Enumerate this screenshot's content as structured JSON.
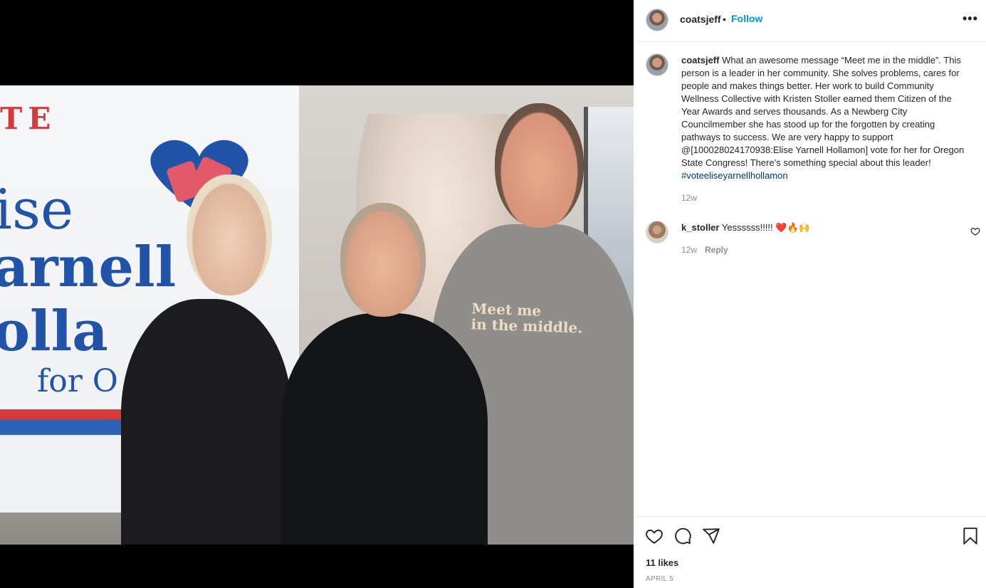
{
  "post": {
    "username": "coatsjeff",
    "follow_separator": "•",
    "follow_label": "Follow",
    "more_label": "•••"
  },
  "photo": {
    "banner_line1": "TE",
    "banner_line2": "ise",
    "banner_line3": "arnell",
    "banner_line4": "olla",
    "banner_line5": "for O",
    "shirt_line1": "Meet me",
    "shirt_line2": "in the middle."
  },
  "caption": {
    "username": "coatsjeff",
    "text": "What an awesome message “Meet me in the middle”. This person is a leader in her community. She solves problems, cares for people and makes things better. Her work to build Community Wellness Collective with Kristen Stoller earned them Citizen of the Year Awards and serves thousands. As a Newberg City Councilmember she has stood up for the forgotten by creating pathways to success. We are very happy to support @[100028024170938:Elise Yarnell Hollamon] vote for her for Oregon State Congress! There’s something special about this leader!",
    "hashtag": "#voteeliseyarnellhollamon",
    "time": "12w"
  },
  "comments": [
    {
      "username": "k_stoller",
      "text": "Yessssss!!!!! ❤️🔥🙌",
      "time": "12w",
      "reply_label": "Reply"
    }
  ],
  "footer": {
    "likes": "11 likes",
    "date": "APRIL 5"
  },
  "icons": {
    "heart": "heart-icon",
    "comment": "comment-icon",
    "share": "share-icon",
    "save": "bookmark-icon"
  },
  "colors": {
    "accent": "#0095f6",
    "hashtag": "#00376b",
    "muted": "#8e8e8e"
  }
}
